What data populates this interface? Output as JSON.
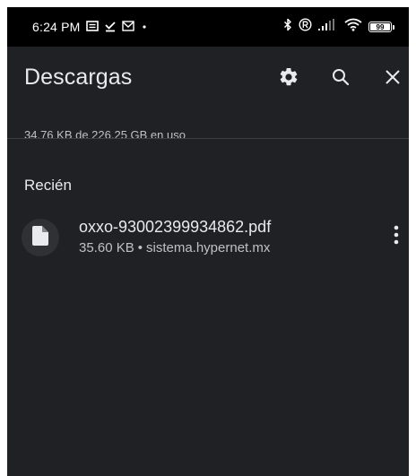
{
  "status_bar": {
    "time": "6:24 PM",
    "notification_icons": [
      "notes-icon",
      "download-done-icon",
      "mail-icon",
      "dot-icon"
    ],
    "system_icons": [
      "bluetooth-icon",
      "registered-icon",
      "signal-icon",
      "wifi-icon",
      "battery-icon"
    ],
    "battery_level": "99"
  },
  "app_bar": {
    "title": "Descargas",
    "actions": [
      "gear-icon",
      "search-icon",
      "close-icon"
    ]
  },
  "storage": {
    "usage_text": "34.76 KB de 226.25 GB en uso"
  },
  "sections": [
    {
      "header": "Recién",
      "items": [
        {
          "icon": "file-icon",
          "title": "oxxo-93002399934862.pdf",
          "size": "35.60 KB",
          "separator": "•",
          "source": "sistema.hypernet.mx",
          "menu_icon": "more-vert-icon"
        }
      ]
    }
  ],
  "colors": {
    "background": "#202124",
    "status_bar": "#000000",
    "primary_text": "#e8eaed",
    "secondary_text": "#bdc1c6",
    "divider": "#3c4043",
    "icon_circle": "#303134"
  }
}
